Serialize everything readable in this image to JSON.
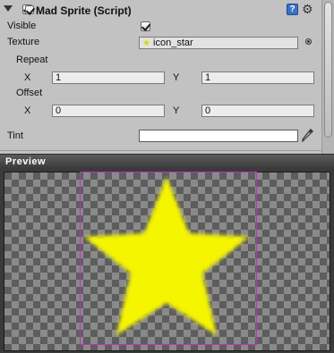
{
  "component": {
    "title": "Mad Sprite (Script)",
    "enabled": true,
    "help_icon": "?",
    "gear_icon": "gear-icon"
  },
  "fields": {
    "visible_label": "Visible",
    "visible_checked": true,
    "texture_label": "Texture",
    "texture_value": "icon_star",
    "repeat_label": "Repeat",
    "repeat_x_label": "X",
    "repeat_x_value": "1",
    "repeat_y_label": "Y",
    "repeat_y_value": "1",
    "offset_label": "Offset",
    "offset_x_label": "X",
    "offset_x_value": "0",
    "offset_y_label": "Y",
    "offset_y_value": "0",
    "tint_label": "Tint",
    "tint_color": "#ffffff"
  },
  "preview": {
    "title": "Preview",
    "sprite_color": "#f5f500",
    "bounds_color": "#c030c0"
  }
}
